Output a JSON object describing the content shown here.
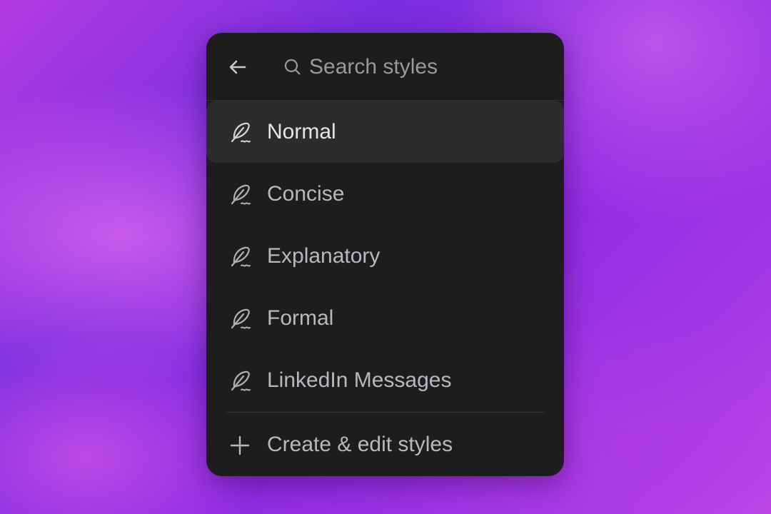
{
  "search": {
    "placeholder": "Search styles",
    "value": ""
  },
  "header": {
    "back_icon": "arrow-left-icon",
    "search_icon": "search-icon"
  },
  "styles": {
    "icon": "feather-pen-icon",
    "selected": "Normal",
    "items": [
      {
        "label": "Normal"
      },
      {
        "label": "Concise"
      },
      {
        "label": "Explanatory"
      },
      {
        "label": "Formal"
      },
      {
        "label": "LinkedIn Messages"
      }
    ]
  },
  "footer": {
    "create_label": "Create & edit styles",
    "create_icon": "plus-icon"
  },
  "colors": {
    "panel_bg": "#1d1d1f",
    "selected_bg": "#2c2c2f",
    "text": "#b9b9bd",
    "text_selected": "#e6e6e8"
  }
}
